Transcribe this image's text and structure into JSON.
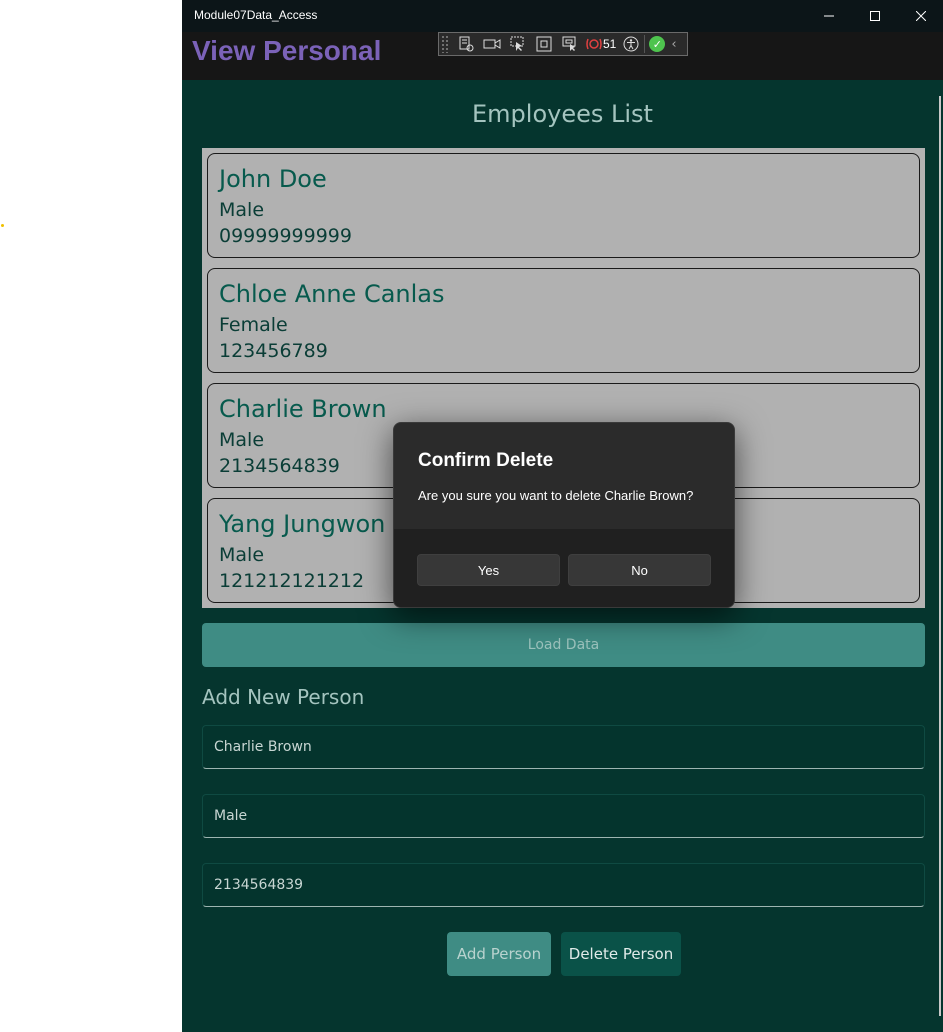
{
  "window": {
    "title": "Module07Data_Access",
    "minimize_icon": "minimize-icon",
    "maximize_icon": "maximize-icon",
    "close_icon": "close-icon"
  },
  "header": {
    "title": "View Personal",
    "title_color": "#7b62b8"
  },
  "dev_toolbar": {
    "binding_failures_count": "51",
    "icons": [
      "live-visual-tree-icon",
      "record-icon",
      "select-element-icon",
      "display-adorners-icon",
      "track-focus-icon",
      "binding-failures-icon",
      "accessibility-icon",
      "hot-reload-check-icon",
      "collapse-chevron-icon"
    ]
  },
  "main": {
    "list_title": "Employees List",
    "employees": [
      {
        "name": "John Doe",
        "gender": "Male",
        "phone": "09999999999"
      },
      {
        "name": "Chloe Anne Canlas",
        "gender": "Female",
        "phone": "123456789"
      },
      {
        "name": "Charlie Brown",
        "gender": "Male",
        "phone": "2134564839"
      },
      {
        "name": "Yang Jungwon",
        "gender": "Male",
        "phone": "121212121212"
      }
    ],
    "load_button": "Load Data",
    "add_title": "Add New Person",
    "fields": {
      "name": "Charlie Brown",
      "gender": "Male",
      "phone": "2134564839"
    },
    "add_button": "Add Person",
    "delete_button": "Delete Person"
  },
  "dialog": {
    "title": "Confirm Delete",
    "message": "Are you sure you want to delete Charlie Brown?",
    "yes_label": "Yes",
    "no_label": "No"
  },
  "colors": {
    "background": "#05352e",
    "accent": "#3f8c84",
    "card": "#b1b1b1"
  }
}
